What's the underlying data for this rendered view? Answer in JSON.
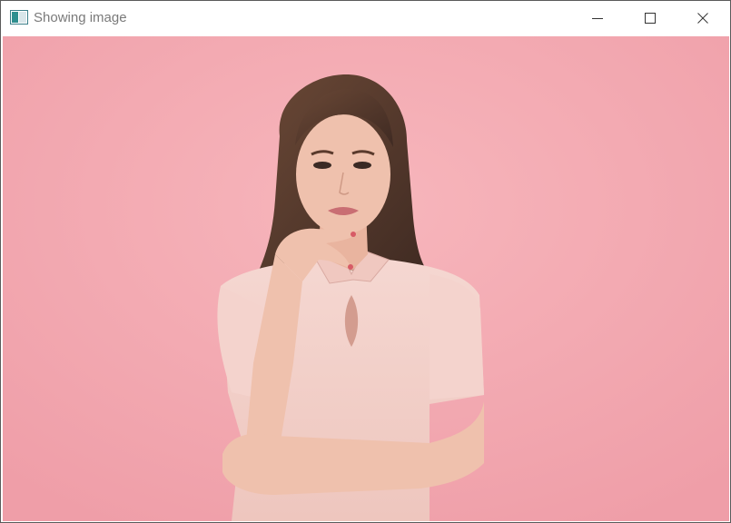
{
  "window": {
    "title": "Showing image",
    "app_icon": "image-window-icon",
    "controls": {
      "minimize": "minimize-icon",
      "maximize": "maximize-icon",
      "close": "close-icon"
    }
  },
  "image": {
    "subject": "photo-of-woman-pink-background",
    "colors": {
      "background": "#f4a9b1",
      "dress": "#f3cfc9",
      "skin": "#efc1ad",
      "hair": "#5b3b2c",
      "lips": "#c96e73"
    }
  }
}
